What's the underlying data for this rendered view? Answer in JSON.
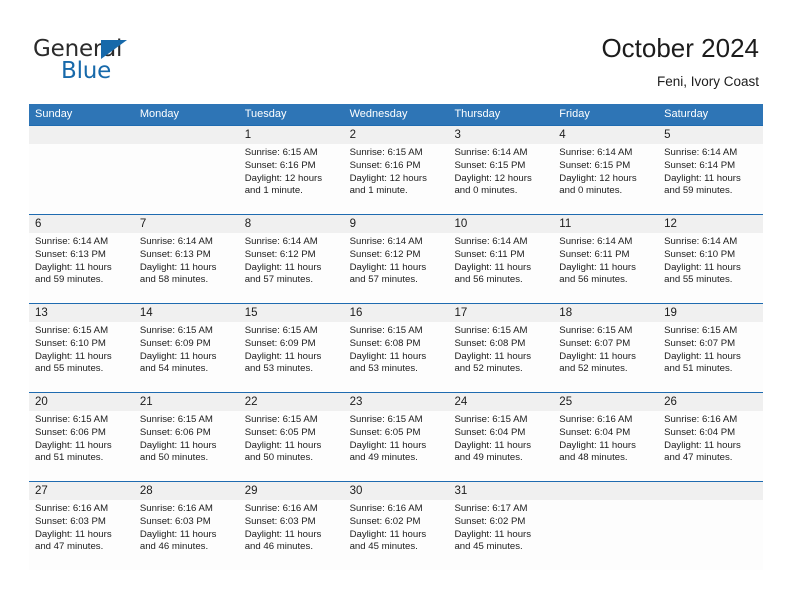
{
  "logo": {
    "word_top": "General",
    "word_bottom": "Blue",
    "triangle_icon": "triangle-icon",
    "color_blue": "#1769aa",
    "color_dark": "#2b2b2b"
  },
  "header": {
    "title": "October 2024",
    "subtitle": "Feni, Ivory Coast"
  },
  "theme": {
    "header_blue": "#2e75b6",
    "rule_blue": "#1f6bb0",
    "date_band": "#f0f0f0"
  },
  "calendar": {
    "weekdays": [
      "Sunday",
      "Monday",
      "Tuesday",
      "Wednesday",
      "Thursday",
      "Friday",
      "Saturday"
    ],
    "weeks": [
      [
        {
          "day": "",
          "sunrise": "",
          "sunset": "",
          "daylight": "",
          "daylight2": ""
        },
        {
          "day": "",
          "sunrise": "",
          "sunset": "",
          "daylight": "",
          "daylight2": ""
        },
        {
          "day": "1",
          "sunrise": "Sunrise: 6:15 AM",
          "sunset": "Sunset: 6:16 PM",
          "daylight": "Daylight: 12 hours",
          "daylight2": "and 1 minute."
        },
        {
          "day": "2",
          "sunrise": "Sunrise: 6:15 AM",
          "sunset": "Sunset: 6:16 PM",
          "daylight": "Daylight: 12 hours",
          "daylight2": "and 1 minute."
        },
        {
          "day": "3",
          "sunrise": "Sunrise: 6:14 AM",
          "sunset": "Sunset: 6:15 PM",
          "daylight": "Daylight: 12 hours",
          "daylight2": "and 0 minutes."
        },
        {
          "day": "4",
          "sunrise": "Sunrise: 6:14 AM",
          "sunset": "Sunset: 6:15 PM",
          "daylight": "Daylight: 12 hours",
          "daylight2": "and 0 minutes."
        },
        {
          "day": "5",
          "sunrise": "Sunrise: 6:14 AM",
          "sunset": "Sunset: 6:14 PM",
          "daylight": "Daylight: 11 hours",
          "daylight2": "and 59 minutes."
        }
      ],
      [
        {
          "day": "6",
          "sunrise": "Sunrise: 6:14 AM",
          "sunset": "Sunset: 6:13 PM",
          "daylight": "Daylight: 11 hours",
          "daylight2": "and 59 minutes."
        },
        {
          "day": "7",
          "sunrise": "Sunrise: 6:14 AM",
          "sunset": "Sunset: 6:13 PM",
          "daylight": "Daylight: 11 hours",
          "daylight2": "and 58 minutes."
        },
        {
          "day": "8",
          "sunrise": "Sunrise: 6:14 AM",
          "sunset": "Sunset: 6:12 PM",
          "daylight": "Daylight: 11 hours",
          "daylight2": "and 57 minutes."
        },
        {
          "day": "9",
          "sunrise": "Sunrise: 6:14 AM",
          "sunset": "Sunset: 6:12 PM",
          "daylight": "Daylight: 11 hours",
          "daylight2": "and 57 minutes."
        },
        {
          "day": "10",
          "sunrise": "Sunrise: 6:14 AM",
          "sunset": "Sunset: 6:11 PM",
          "daylight": "Daylight: 11 hours",
          "daylight2": "and 56 minutes."
        },
        {
          "day": "11",
          "sunrise": "Sunrise: 6:14 AM",
          "sunset": "Sunset: 6:11 PM",
          "daylight": "Daylight: 11 hours",
          "daylight2": "and 56 minutes."
        },
        {
          "day": "12",
          "sunrise": "Sunrise: 6:14 AM",
          "sunset": "Sunset: 6:10 PM",
          "daylight": "Daylight: 11 hours",
          "daylight2": "and 55 minutes."
        }
      ],
      [
        {
          "day": "13",
          "sunrise": "Sunrise: 6:15 AM",
          "sunset": "Sunset: 6:10 PM",
          "daylight": "Daylight: 11 hours",
          "daylight2": "and 55 minutes."
        },
        {
          "day": "14",
          "sunrise": "Sunrise: 6:15 AM",
          "sunset": "Sunset: 6:09 PM",
          "daylight": "Daylight: 11 hours",
          "daylight2": "and 54 minutes."
        },
        {
          "day": "15",
          "sunrise": "Sunrise: 6:15 AM",
          "sunset": "Sunset: 6:09 PM",
          "daylight": "Daylight: 11 hours",
          "daylight2": "and 53 minutes."
        },
        {
          "day": "16",
          "sunrise": "Sunrise: 6:15 AM",
          "sunset": "Sunset: 6:08 PM",
          "daylight": "Daylight: 11 hours",
          "daylight2": "and 53 minutes."
        },
        {
          "day": "17",
          "sunrise": "Sunrise: 6:15 AM",
          "sunset": "Sunset: 6:08 PM",
          "daylight": "Daylight: 11 hours",
          "daylight2": "and 52 minutes."
        },
        {
          "day": "18",
          "sunrise": "Sunrise: 6:15 AM",
          "sunset": "Sunset: 6:07 PM",
          "daylight": "Daylight: 11 hours",
          "daylight2": "and 52 minutes."
        },
        {
          "day": "19",
          "sunrise": "Sunrise: 6:15 AM",
          "sunset": "Sunset: 6:07 PM",
          "daylight": "Daylight: 11 hours",
          "daylight2": "and 51 minutes."
        }
      ],
      [
        {
          "day": "20",
          "sunrise": "Sunrise: 6:15 AM",
          "sunset": "Sunset: 6:06 PM",
          "daylight": "Daylight: 11 hours",
          "daylight2": "and 51 minutes."
        },
        {
          "day": "21",
          "sunrise": "Sunrise: 6:15 AM",
          "sunset": "Sunset: 6:06 PM",
          "daylight": "Daylight: 11 hours",
          "daylight2": "and 50 minutes."
        },
        {
          "day": "22",
          "sunrise": "Sunrise: 6:15 AM",
          "sunset": "Sunset: 6:05 PM",
          "daylight": "Daylight: 11 hours",
          "daylight2": "and 50 minutes."
        },
        {
          "day": "23",
          "sunrise": "Sunrise: 6:15 AM",
          "sunset": "Sunset: 6:05 PM",
          "daylight": "Daylight: 11 hours",
          "daylight2": "and 49 minutes."
        },
        {
          "day": "24",
          "sunrise": "Sunrise: 6:15 AM",
          "sunset": "Sunset: 6:04 PM",
          "daylight": "Daylight: 11 hours",
          "daylight2": "and 49 minutes."
        },
        {
          "day": "25",
          "sunrise": "Sunrise: 6:16 AM",
          "sunset": "Sunset: 6:04 PM",
          "daylight": "Daylight: 11 hours",
          "daylight2": "and 48 minutes."
        },
        {
          "day": "26",
          "sunrise": "Sunrise: 6:16 AM",
          "sunset": "Sunset: 6:04 PM",
          "daylight": "Daylight: 11 hours",
          "daylight2": "and 47 minutes."
        }
      ],
      [
        {
          "day": "27",
          "sunrise": "Sunrise: 6:16 AM",
          "sunset": "Sunset: 6:03 PM",
          "daylight": "Daylight: 11 hours",
          "daylight2": "and 47 minutes."
        },
        {
          "day": "28",
          "sunrise": "Sunrise: 6:16 AM",
          "sunset": "Sunset: 6:03 PM",
          "daylight": "Daylight: 11 hours",
          "daylight2": "and 46 minutes."
        },
        {
          "day": "29",
          "sunrise": "Sunrise: 6:16 AM",
          "sunset": "Sunset: 6:03 PM",
          "daylight": "Daylight: 11 hours",
          "daylight2": "and 46 minutes."
        },
        {
          "day": "30",
          "sunrise": "Sunrise: 6:16 AM",
          "sunset": "Sunset: 6:02 PM",
          "daylight": "Daylight: 11 hours",
          "daylight2": "and 45 minutes."
        },
        {
          "day": "31",
          "sunrise": "Sunrise: 6:17 AM",
          "sunset": "Sunset: 6:02 PM",
          "daylight": "Daylight: 11 hours",
          "daylight2": "and 45 minutes."
        },
        {
          "day": "",
          "sunrise": "",
          "sunset": "",
          "daylight": "",
          "daylight2": ""
        },
        {
          "day": "",
          "sunrise": "",
          "sunset": "",
          "daylight": "",
          "daylight2": ""
        }
      ]
    ]
  }
}
